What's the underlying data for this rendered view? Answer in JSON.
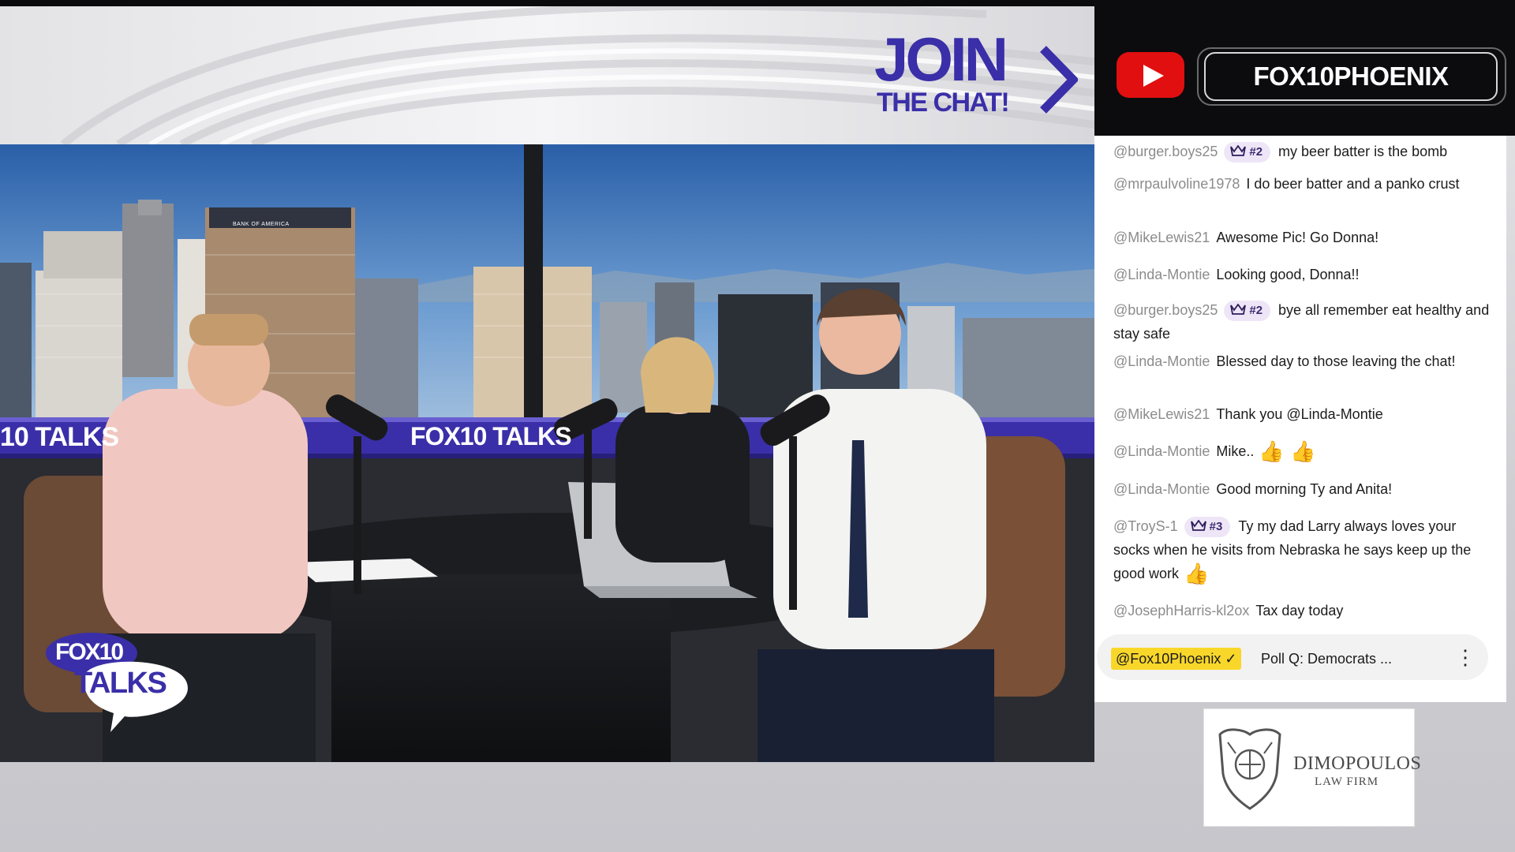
{
  "promo": {
    "join_big": "JOIN",
    "join_small": "THE CHAT!"
  },
  "video": {
    "set_banner": "FOX10 TALKS",
    "banner_left": "10 TALKS",
    "banner_mid": "FOX10 TALKS",
    "logo_top": "FOX10",
    "logo_bottom": "TALKS",
    "building_sign": "BANK OF AMERICA"
  },
  "channel": {
    "name": "FOX10PHOENIX",
    "platform_icon": "youtube-icon"
  },
  "chat": {
    "messages": [
      {
        "user": "@burger.boys25",
        "badge": "#2",
        "text": "my beer batter is the bomb"
      },
      {
        "user": "@mrpaulvoline1978",
        "text": "I do beer batter and a panko crust"
      },
      {
        "user": "@MikeLewis21",
        "text": "Awesome Pic! Go Donna!"
      },
      {
        "user": "@Linda-Montie",
        "text": "Looking good, Donna!!"
      },
      {
        "user": "@burger.boys25",
        "badge": "#2",
        "text": "bye all remember eat healthy and stay safe"
      },
      {
        "user": "@Linda-Montie",
        "text": "Blessed day to those leaving the chat!"
      },
      {
        "user": "@MikeLewis21",
        "text": "Thank you @Linda-Montie"
      },
      {
        "user": "@Linda-Montie",
        "text": "Mike..",
        "emoji": "👍 👍"
      },
      {
        "user": "@Linda-Montie",
        "text": "Good morning Ty and Anita!"
      },
      {
        "user": "@TroyS-1",
        "badge": "#3",
        "text": "Ty my dad Larry always loves your socks when he visits from Nebraska he says keep up the good work",
        "emoji": "👍"
      },
      {
        "user": "@JosephHarris-kl2ox",
        "text": "Tax day today"
      }
    ],
    "pinned": {
      "user": "@Fox10Phoenix ✓",
      "text": "Poll Q: Democrats ...",
      "more": "⋮"
    }
  },
  "sponsor": {
    "name": "DIMOPOULOS",
    "sub": "LAW FIRM"
  },
  "colors": {
    "brand_purple": "#3a2fa8",
    "youtube_red": "#e10f10",
    "pin_yellow": "#f9d72a",
    "badge_bg": "#eee6f7"
  }
}
